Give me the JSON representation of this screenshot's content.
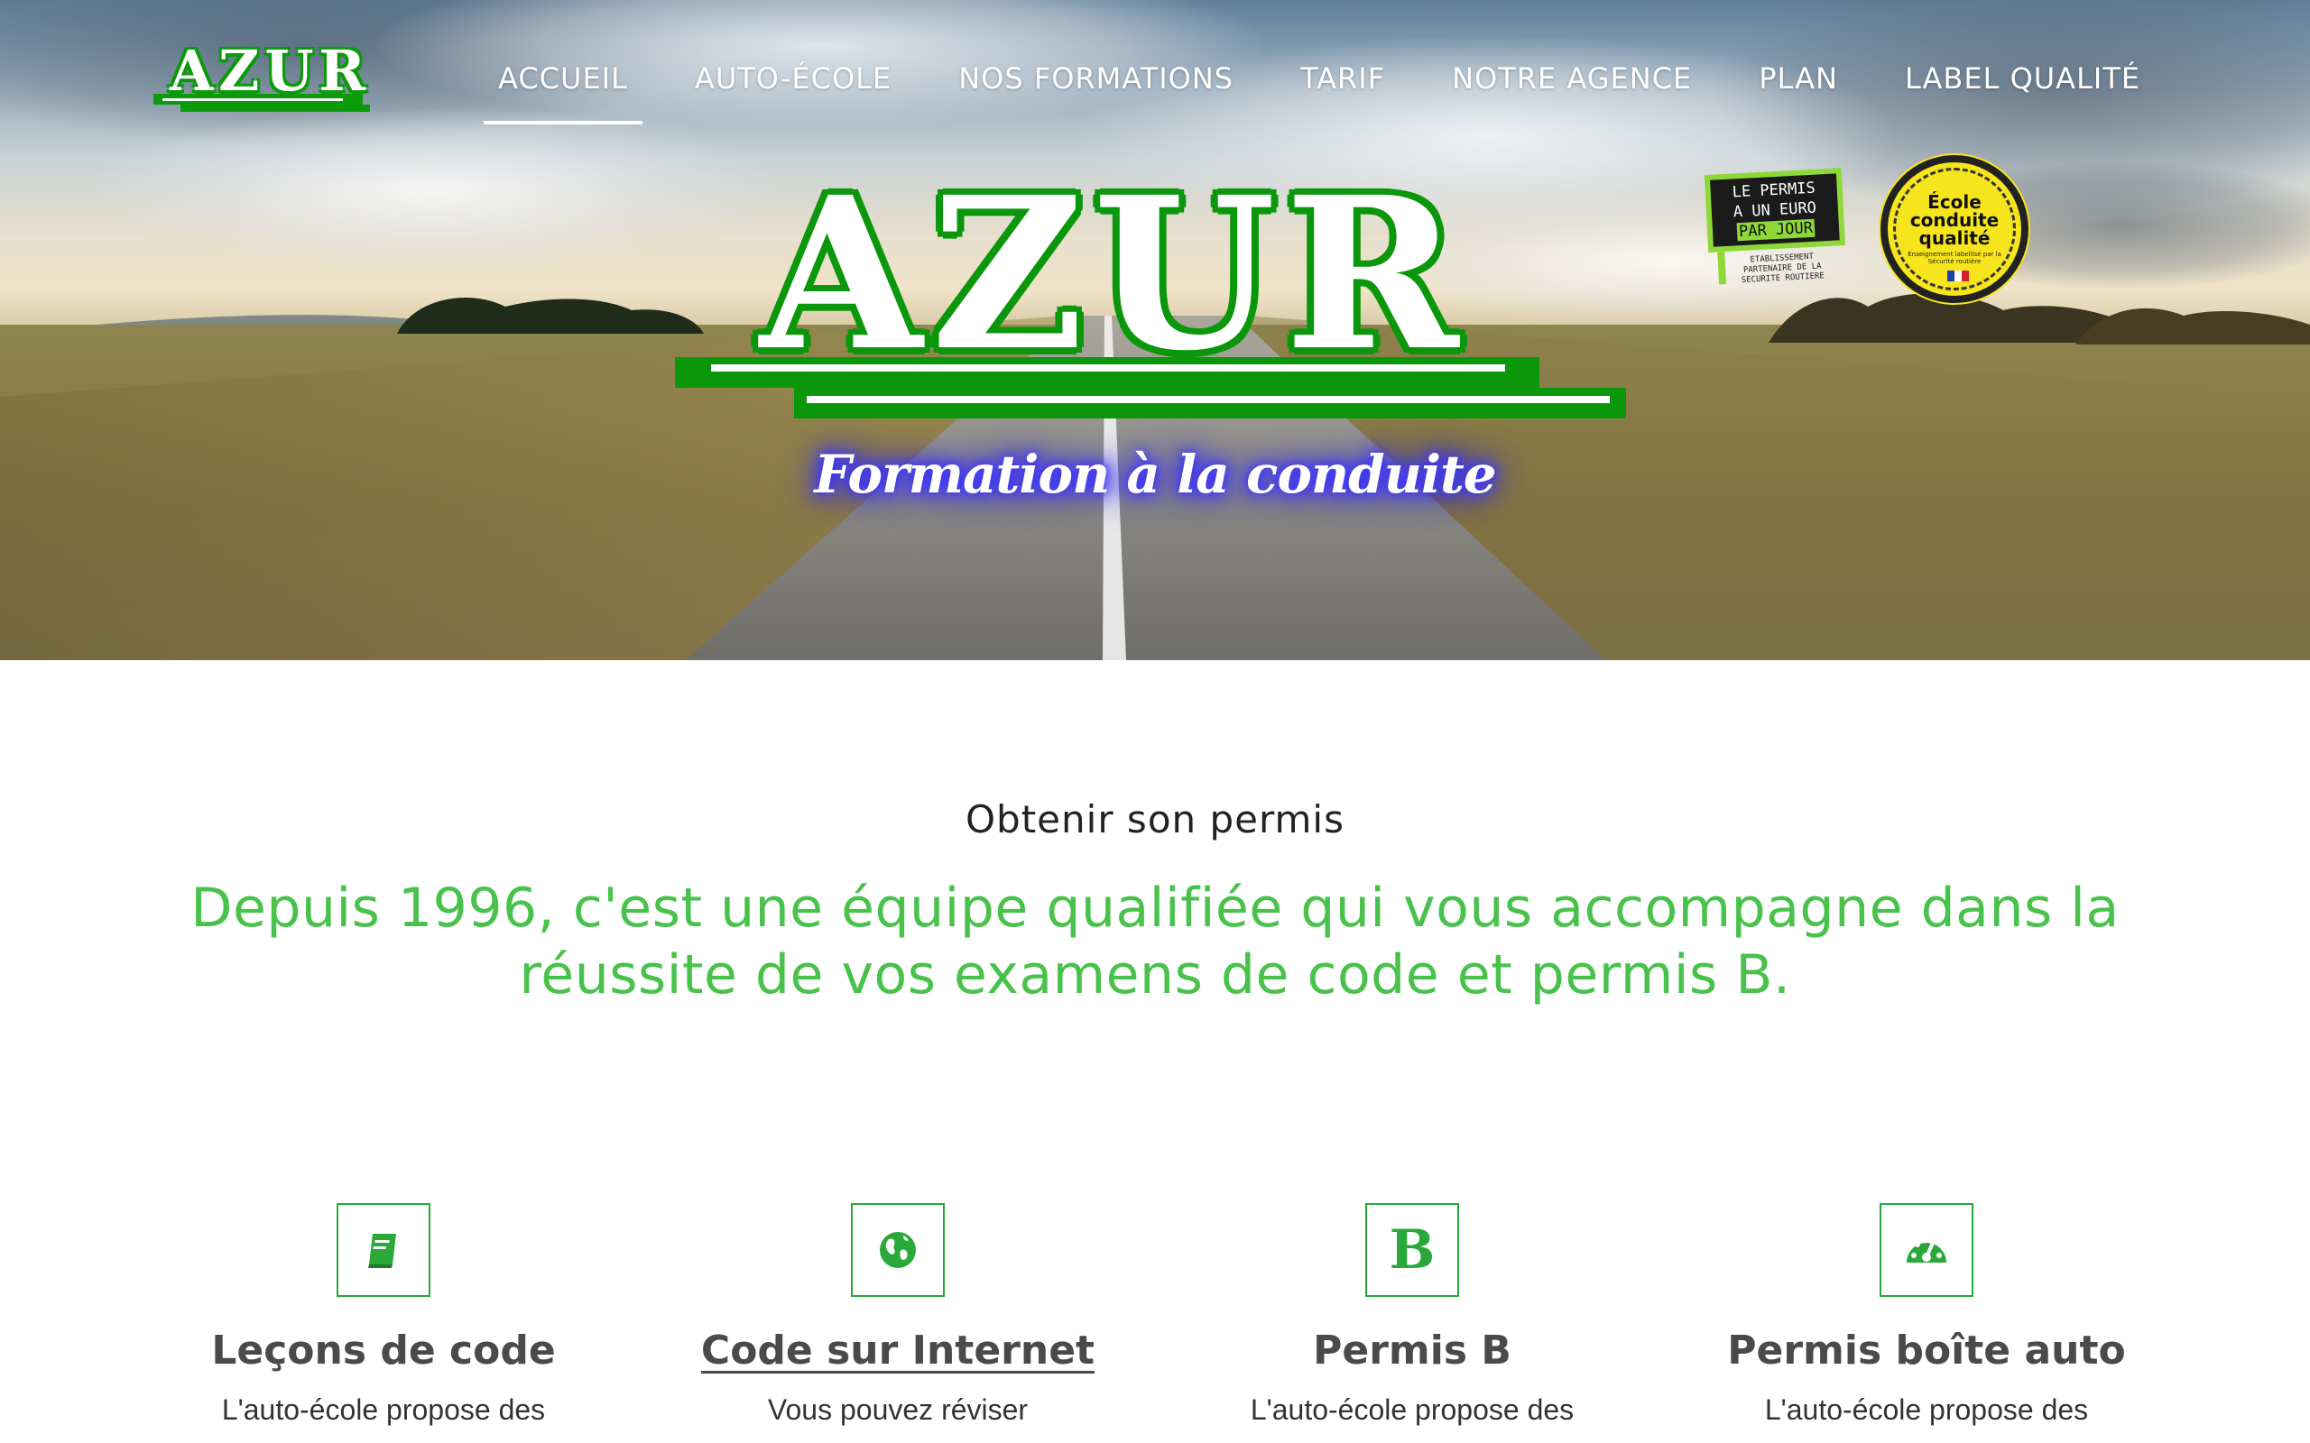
{
  "header": {
    "logo_text": "AZUR",
    "nav": [
      {
        "label": "ACCUEIL",
        "active": true
      },
      {
        "label": "AUTO-ÉCOLE",
        "active": false
      },
      {
        "label": "NOS FORMATIONS",
        "active": false
      },
      {
        "label": "TARIF",
        "active": false
      },
      {
        "label": "NOTRE AGENCE",
        "active": false
      },
      {
        "label": "PLAN",
        "active": false
      },
      {
        "label": "LABEL QUALITÉ",
        "active": false
      }
    ]
  },
  "hero": {
    "logo_text": "AZUR",
    "tagline": "Formation à la conduite",
    "badge_euro": {
      "line1": "LE PERMIS",
      "line2": "A UN EURO",
      "line3": "PAR JOUR",
      "caption": "ETABLISSEMENT PARTENAIRE DE LA SECURITE ROUTIERE"
    },
    "badge_quality": {
      "title": "École conduite qualité",
      "sub": "Enseignement labellisé par la Sécurité routière"
    }
  },
  "intro": {
    "subtitle": "Obtenir son permis",
    "headline": "Depuis 1996, c'est une équipe qualifiée qui vous accompagne dans la réussite de vos examens de code et permis B."
  },
  "features": [
    {
      "icon": "book-icon",
      "title": "Leçons de code",
      "desc": "L'auto-école propose des",
      "is_link": false
    },
    {
      "icon": "globe-icon",
      "title": "Code sur Internet",
      "desc": "Vous pouvez réviser",
      "is_link": true
    },
    {
      "icon": "letter-b-icon",
      "icon_glyph": "B",
      "title": "Permis B",
      "desc": "L'auto-école propose des",
      "is_link": false
    },
    {
      "icon": "speedometer-icon",
      "title": "Permis boîte auto",
      "desc": "L'auto-école propose des",
      "is_link": false
    }
  ],
  "colors": {
    "brand_green": "#0b970b",
    "headline_green": "#49c24c",
    "icon_border": "#27a83a",
    "tagline_glow": "#3b33ff"
  }
}
